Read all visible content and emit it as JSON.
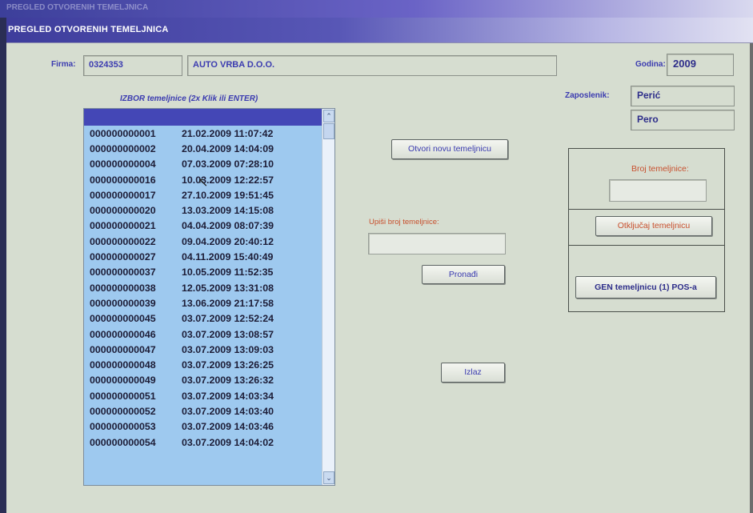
{
  "window": {
    "outer_title": "PREGLED OTVORENIH TEMELJNICA",
    "title": "PREGLED OTVORENIH TEMELJNICA"
  },
  "firma": {
    "label": "Firma:",
    "code": "0324353",
    "name": "AUTO VRBA D.O.O."
  },
  "godina": {
    "label": "Godina:",
    "value": "2009"
  },
  "zaposlenik": {
    "label": "Zaposlenik:",
    "surname": "Perić",
    "name": "Pero"
  },
  "list": {
    "caption": "IZBOR temeljnice (2x Klik ili ENTER)",
    "rows": [
      {
        "num": "000000000001",
        "date": "21.02.2009 11:07:42"
      },
      {
        "num": "000000000002",
        "date": "20.04.2009 14:04:09"
      },
      {
        "num": "000000000004",
        "date": "07.03.2009 07:28:10"
      },
      {
        "num": "000000000016",
        "date": "10.03.2009 12:22:57"
      },
      {
        "num": "000000000017",
        "date": "27.10.2009 19:51:45"
      },
      {
        "num": "000000000020",
        "date": "13.03.2009 14:15:08"
      },
      {
        "num": "000000000021",
        "date": "04.04.2009 08:07:39"
      },
      {
        "num": "000000000022",
        "date": "09.04.2009 20:40:12"
      },
      {
        "num": "000000000027",
        "date": "04.11.2009 15:40:49"
      },
      {
        "num": "000000000037",
        "date": "10.05.2009 11:52:35"
      },
      {
        "num": "000000000038",
        "date": "12.05.2009 13:31:08"
      },
      {
        "num": "000000000039",
        "date": "13.06.2009 21:17:58"
      },
      {
        "num": "000000000045",
        "date": "03.07.2009 12:52:24"
      },
      {
        "num": "000000000046",
        "date": "03.07.2009 13:08:57"
      },
      {
        "num": "000000000047",
        "date": "03.07.2009 13:09:03"
      },
      {
        "num": "000000000048",
        "date": "03.07.2009 13:26:25"
      },
      {
        "num": "000000000049",
        "date": "03.07.2009 13:26:32"
      },
      {
        "num": "000000000051",
        "date": "03.07.2009 14:03:34"
      },
      {
        "num": "000000000052",
        "date": "03.07.2009 14:03:40"
      },
      {
        "num": "000000000053",
        "date": "03.07.2009 14:03:46"
      },
      {
        "num": "000000000054",
        "date": "03.07.2009 14:04:02"
      }
    ]
  },
  "actions": {
    "open_new": "Otvori novu temeljnicu",
    "search_label": "Upiši broj temeljnice:",
    "search_value": "",
    "find": "Pronađi",
    "exit": "Izlaz"
  },
  "panel": {
    "broj_label": "Broj temeljnice:",
    "broj_value": "",
    "unlock": "Otključaj temeljnicu",
    "gen": "GEN temeljnicu (1) POS-a"
  },
  "colors": {
    "form_bg": "#d6ddd0",
    "list_bg": "#9ec9ef",
    "title_blue": "#3d3c9b",
    "label_blue": "#3b3bb0",
    "label_red": "#c8502e"
  }
}
